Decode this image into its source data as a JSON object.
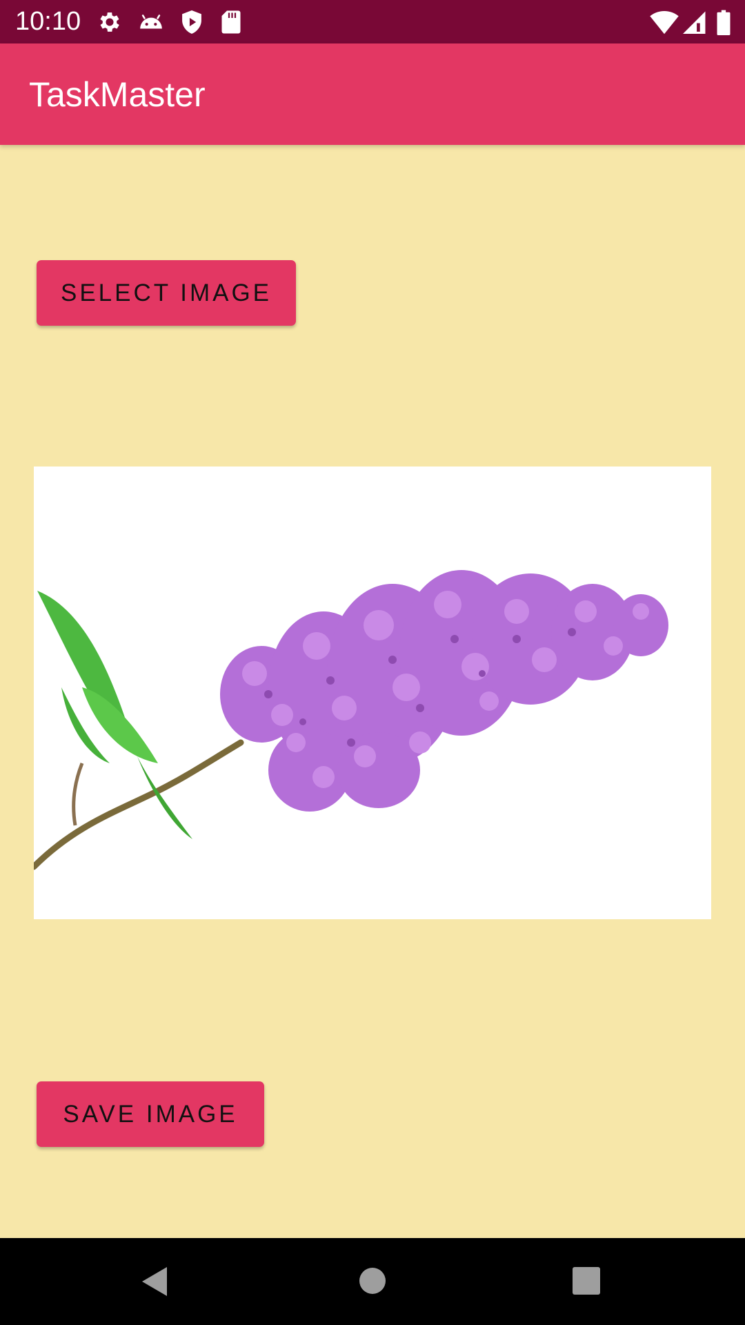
{
  "status_bar": {
    "time": "10:10",
    "left_icons": [
      "gear-icon",
      "android-icon",
      "shield-icon",
      "sd-card-icon"
    ],
    "right_icons": [
      "wifi-icon",
      "signal-icon",
      "battery-icon"
    ]
  },
  "app_bar": {
    "title": "TaskMaster"
  },
  "main": {
    "select_button_label": "SELECT IMAGE",
    "save_button_label": "SAVE IMAGE",
    "image": {
      "subject": "lilac-flower-branch"
    }
  },
  "nav_bar": {
    "buttons": [
      "back-icon",
      "home-icon",
      "recents-icon"
    ]
  },
  "colors": {
    "status_bar": "#790836",
    "app_bar": "#E33763",
    "background": "#F7E7A9",
    "button": "#E33763",
    "nav_bar": "#000000"
  }
}
